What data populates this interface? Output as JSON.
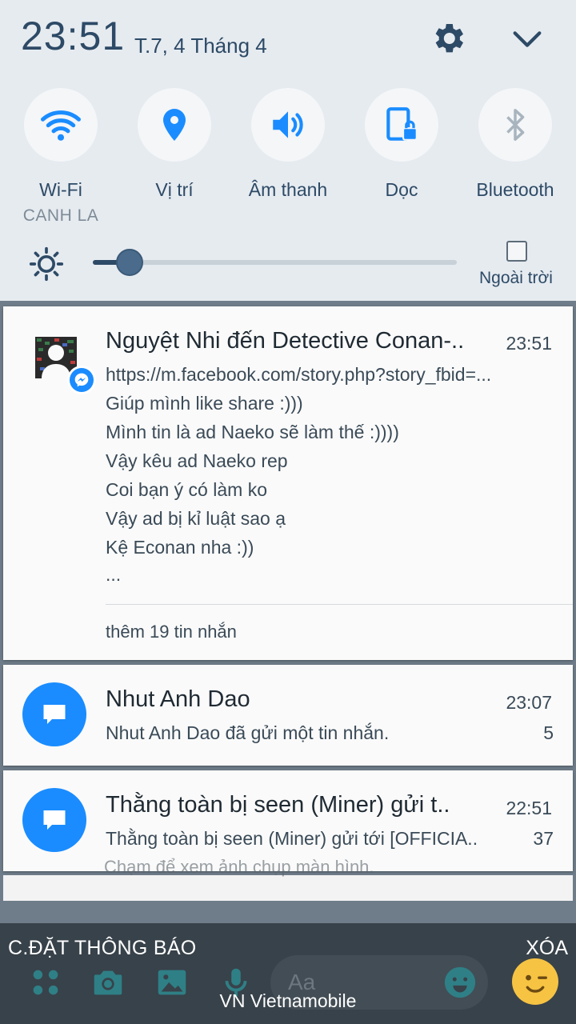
{
  "status": {
    "time": "23:51",
    "date": "T.7, 4 Tháng 4"
  },
  "quick_settings": [
    {
      "label": "Wi-Fi",
      "sub": "CANH LA",
      "icon": "wifi-icon"
    },
    {
      "label": "Vị trí",
      "icon": "location-icon"
    },
    {
      "label": "Âm thanh",
      "icon": "sound-icon"
    },
    {
      "label": "Dọc",
      "icon": "rotation-lock-icon"
    },
    {
      "label": "Bluetooth",
      "icon": "bluetooth-icon"
    }
  ],
  "brightness": {
    "level": 0.1,
    "outdoor_label": "Ngoài trời"
  },
  "notifications": [
    {
      "title": "Nguyệt Nhi đến Detective Conan-..",
      "time": "23:51",
      "lines": [
        "https://m.facebook.com/story.php?story_fbid=...",
        "Giúp mình like share :)))",
        "Mình tin là ad Naeko sẽ làm thế :))))",
        "Vậy kêu ad Naeko rep",
        "Coi bạn ý có làm ko",
        "Vậy ad bị kỉ luật sao ạ",
        "Kệ Econan nha :))",
        "..."
      ],
      "more": "thêm 19 tin nhắn"
    },
    {
      "title": "Nhut Anh Dao",
      "time": "23:07",
      "text": "Nhut Anh Dao đã gửi một tin nhắn.",
      "count": "5"
    },
    {
      "title": "Thằng toàn bị seen (Miner) gửi t..",
      "time": "22:51",
      "text": "Thằng toàn bị seen (Miner) gửi tới [OFFICIA..",
      "count": "37"
    }
  ],
  "background_text": "Chạm để xem ảnh chụp màn hình.",
  "footer": {
    "settings": "C.ĐẶT THÔNG BÁO",
    "clear": "XÓA",
    "carrier": "VN Vietnamobile",
    "input_placeholder": "Aa"
  },
  "colors": {
    "accent": "#2d4a66",
    "messenger": "#1a8cff",
    "panel": "#e6ebf0",
    "footer": "#38424a"
  }
}
